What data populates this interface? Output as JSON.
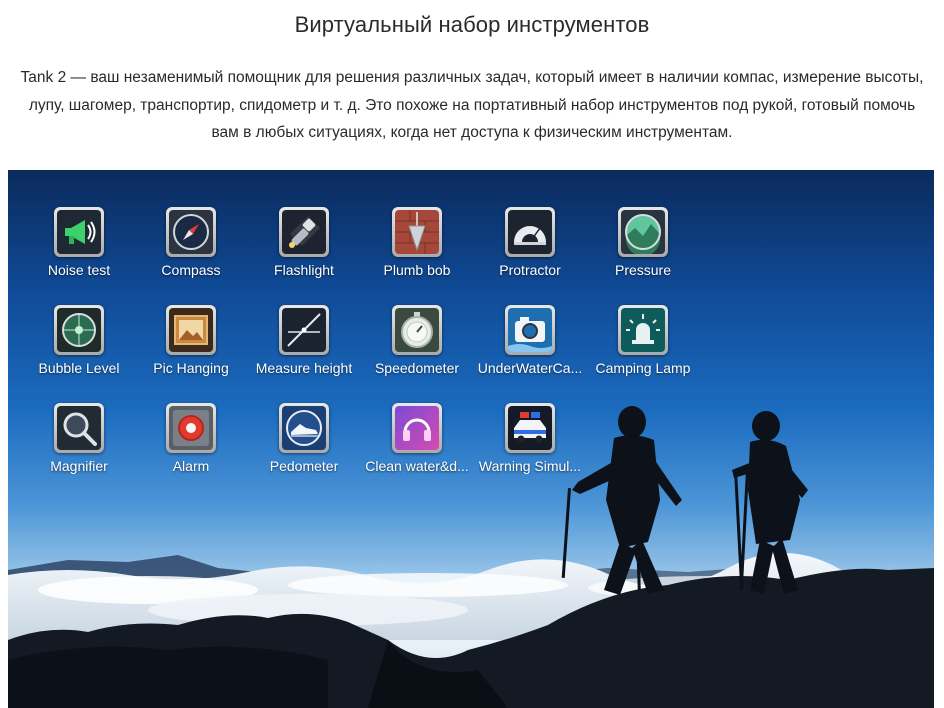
{
  "heading": "Виртуальный набор инструментов",
  "description": "Tank 2 — ваш незаменимый помощник для решения различных задач, который имеет в наличии компас, измерение высоты, лупу, шагомер, транспортир, спидометр и т. д. Это похоже на портативный набор инструментов под рукой, готовый помочь вам в любых ситуациях, когда нет доступа к физическим инструментам.",
  "apps": [
    {
      "label": "Noise test",
      "icon": "megaphone-icon"
    },
    {
      "label": "Compass",
      "icon": "compass-icon"
    },
    {
      "label": "Flashlight",
      "icon": "flashlight-icon"
    },
    {
      "label": "Plumb bob",
      "icon": "plumb-bob-icon"
    },
    {
      "label": "Protractor",
      "icon": "protractor-icon"
    },
    {
      "label": "Pressure",
      "icon": "pressure-icon"
    },
    {
      "label": "Bubble Level",
      "icon": "bubble-level-icon"
    },
    {
      "label": "Pic Hanging",
      "icon": "picture-frame-icon"
    },
    {
      "label": "Measure height",
      "icon": "measure-height-icon"
    },
    {
      "label": "Speedometer",
      "icon": "stopwatch-icon"
    },
    {
      "label": "UnderWaterCa...",
      "icon": "underwater-camera-icon"
    },
    {
      "label": "Camping Lamp",
      "icon": "beacon-lamp-icon"
    },
    {
      "label": "Magnifier",
      "icon": "magnifier-icon"
    },
    {
      "label": "Alarm",
      "icon": "alarm-button-icon"
    },
    {
      "label": "Pedometer",
      "icon": "shoe-icon"
    },
    {
      "label": "Clean water&d...",
      "icon": "headphones-icon"
    },
    {
      "label": "Warning Simul...",
      "icon": "police-car-icon"
    }
  ]
}
